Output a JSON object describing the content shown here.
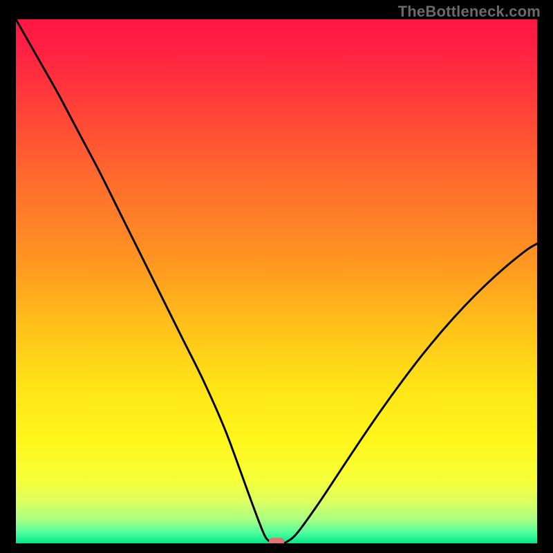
{
  "watermark": "TheBottleneck.com",
  "chart_data": {
    "type": "line",
    "title": "",
    "xlabel": "",
    "ylabel": "",
    "xlim": [
      0,
      100
    ],
    "ylim": [
      0,
      100
    ],
    "x": [
      0,
      4,
      8,
      12,
      16,
      20,
      24,
      28,
      32,
      36,
      40,
      43,
      45,
      47,
      48,
      49,
      50,
      51,
      52,
      54,
      58,
      62,
      66,
      70,
      74,
      78,
      82,
      86,
      90,
      94,
      98,
      100
    ],
    "values": [
      100,
      93,
      86,
      78.5,
      71,
      63,
      55,
      47,
      39,
      31,
      22,
      14,
      8.5,
      3.2,
      1.0,
      0.2,
      0.0,
      0.0,
      0.3,
      2.0,
      7.5,
      13.5,
      19.5,
      25.3,
      30.8,
      36.0,
      40.8,
      45.2,
      49.2,
      52.8,
      56.0,
      57.2
    ],
    "series_name": "bottleneck-curve",
    "marker": {
      "x": 50,
      "y": 0
    },
    "gradient_stops": [
      {
        "offset": 0.0,
        "color": "#ff1744"
      },
      {
        "offset": 0.05,
        "color": "#ff1f44"
      },
      {
        "offset": 0.15,
        "color": "#ff3b3a"
      },
      {
        "offset": 0.3,
        "color": "#ff6a2e"
      },
      {
        "offset": 0.45,
        "color": "#ff9222"
      },
      {
        "offset": 0.58,
        "color": "#ffbf1a"
      },
      {
        "offset": 0.7,
        "color": "#ffe418"
      },
      {
        "offset": 0.8,
        "color": "#fff61a"
      },
      {
        "offset": 0.88,
        "color": "#f6ff3a"
      },
      {
        "offset": 0.92,
        "color": "#dcff60"
      },
      {
        "offset": 0.955,
        "color": "#a8ff86"
      },
      {
        "offset": 0.98,
        "color": "#4dffa0"
      },
      {
        "offset": 1.0,
        "color": "#00e884"
      }
    ]
  }
}
